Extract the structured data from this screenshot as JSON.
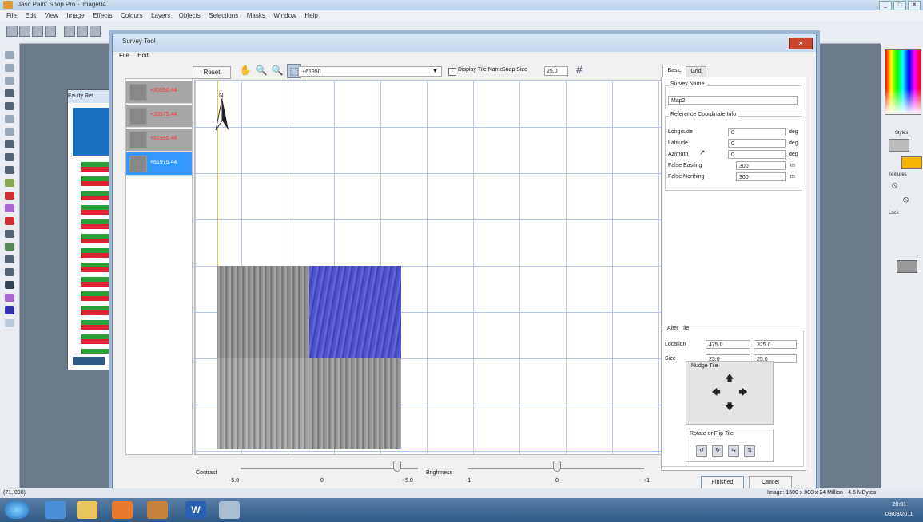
{
  "app": {
    "title": "Jasc Paint Shop Pro - Image04",
    "menu": [
      "File",
      "Edit",
      "View",
      "Image",
      "Effects",
      "Colours",
      "Layers",
      "Objects",
      "Selections",
      "Masks",
      "Window",
      "Help"
    ],
    "window_buttons": [
      "_",
      "□",
      "✕"
    ]
  },
  "bg_window": {
    "title": "Faulty Ret"
  },
  "dialog": {
    "title": "Survey Tool",
    "close_label": "✕",
    "menu": [
      "File",
      "Edit"
    ],
    "files": [
      {
        "label": "+20950.44"
      },
      {
        "label": "+20975.44"
      },
      {
        "label": "+61950.44"
      },
      {
        "label": "+61975.44",
        "selected": true
      }
    ],
    "toolbar": {
      "reset_label": "Reset",
      "file_select_value": "+61950",
      "display_tile_name_label": "Display Tile Name",
      "snap_size_label": "Snap Size",
      "snap_size_value": "25.0"
    },
    "north_label": "N",
    "sliders": {
      "contrast": {
        "label": "Contrast",
        "ticks": [
          "-5.0",
          "0",
          "+5.0"
        ]
      },
      "brightness": {
        "label": "Brightness",
        "ticks": [
          "-1",
          "0",
          "+1"
        ]
      }
    },
    "tabs": [
      "Basic",
      "Grid"
    ],
    "basic": {
      "survey_name_group": "Survey Name",
      "survey_name_value": "Map2",
      "ref_group": "Reference Coordinate Info",
      "longitude_label": "Longitude",
      "longitude_value": "0",
      "longitude_unit": "deg",
      "latitude_label": "Latitude",
      "latitude_value": "0",
      "latitude_unit": "deg",
      "azimuth_label": "Azimuth",
      "azimuth_value": "0",
      "azimuth_unit": "deg",
      "easting_label": "False Easting",
      "easting_value": "300",
      "easting_unit": "m",
      "northing_label": "False Northing",
      "northing_value": "300",
      "northing_unit": "m",
      "alter_group": "Alter Tile",
      "location_label": "Location",
      "location_x": "475.0",
      "location_y": "325.0",
      "size_label": "Size",
      "size_x": "25.0",
      "size_y": "25.0",
      "nudge_label": "Nudge Tile",
      "rotate_label": "Rotate or Flip Tile"
    },
    "finished_label": "Finished",
    "cancel_label": "Cancel"
  },
  "status": {
    "left": "(71, 898)",
    "right": "Image: 1600 x 800 x 24 Million - 4.6 MBytes"
  },
  "right_panel": {
    "styles_label": "Styles",
    "textures_label": "Textures",
    "lock_label": "Lock"
  },
  "clock": {
    "time": "20:01",
    "date": "09/03/2011"
  },
  "colors": {
    "selection_blue": "#3399ff",
    "file_label_red": "#ff3333",
    "grid_line": "#b8c8e6",
    "axis": "#e6c24a",
    "tile_overlay": "#5a5ad8"
  }
}
